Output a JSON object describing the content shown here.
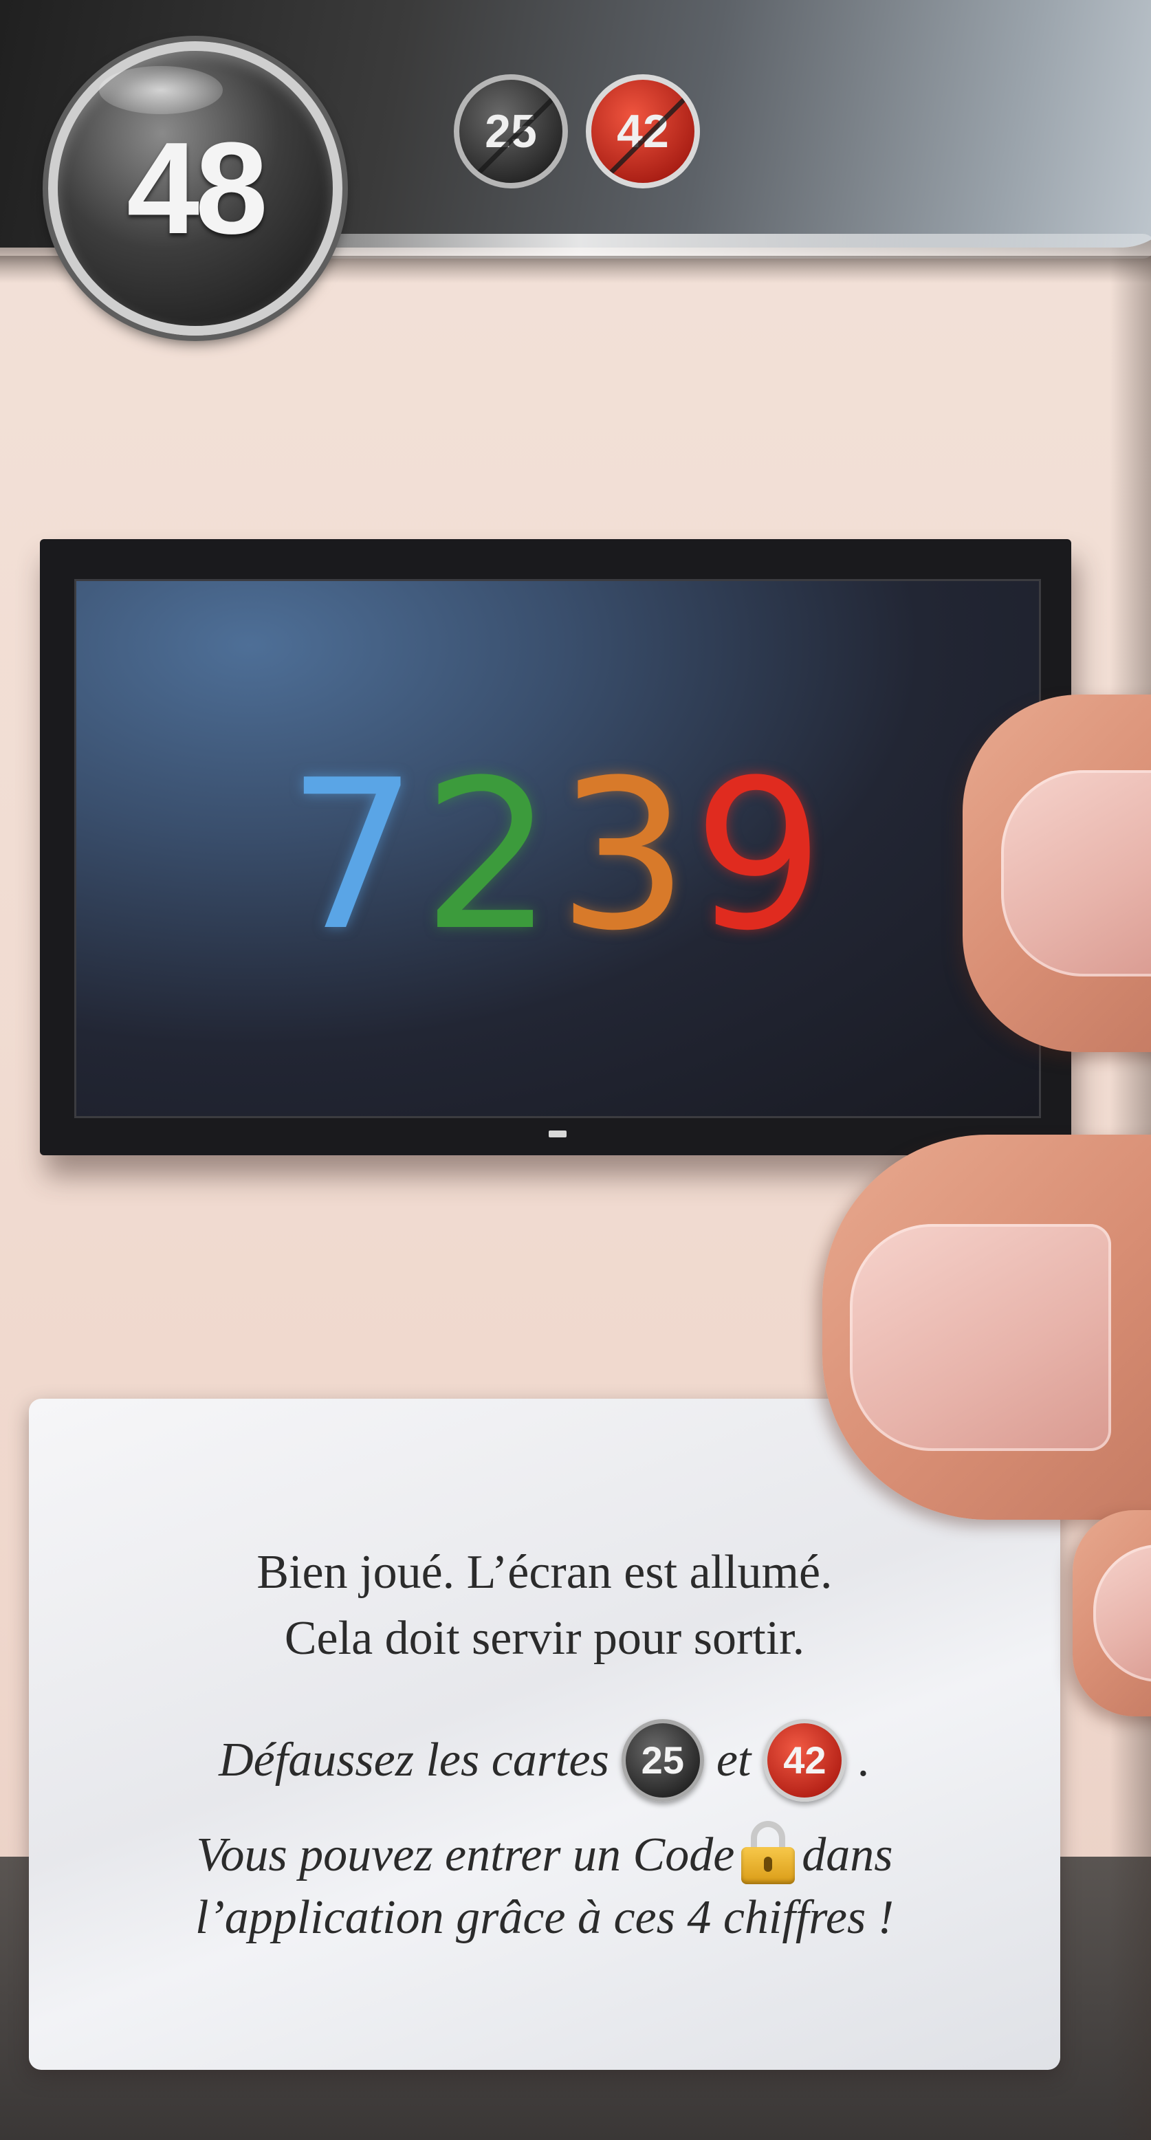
{
  "card": {
    "number": "48",
    "discard_badges": [
      "25",
      "42"
    ]
  },
  "tv": {
    "code_digits": [
      "7",
      "2",
      "3",
      "9"
    ],
    "digit_colors": [
      "#5aa5e6",
      "#3c9b3c",
      "#d87a2a",
      "#e02b1f"
    ]
  },
  "panel": {
    "line1": "Bien joué. L’écran est allumé.",
    "line2": "Cela doit servir pour sortir.",
    "line3_prefix": "Défaussez les cartes",
    "line3_badge1": "25",
    "line3_mid": "et",
    "line3_badge2": "42",
    "line3_suffix": ".",
    "line4_prefix": "Vous pouvez entrer un Code",
    "line4_icon": "padlock-icon",
    "line4_suffix": "dans",
    "line5": "l’application grâce à ces 4 chiffres !"
  }
}
